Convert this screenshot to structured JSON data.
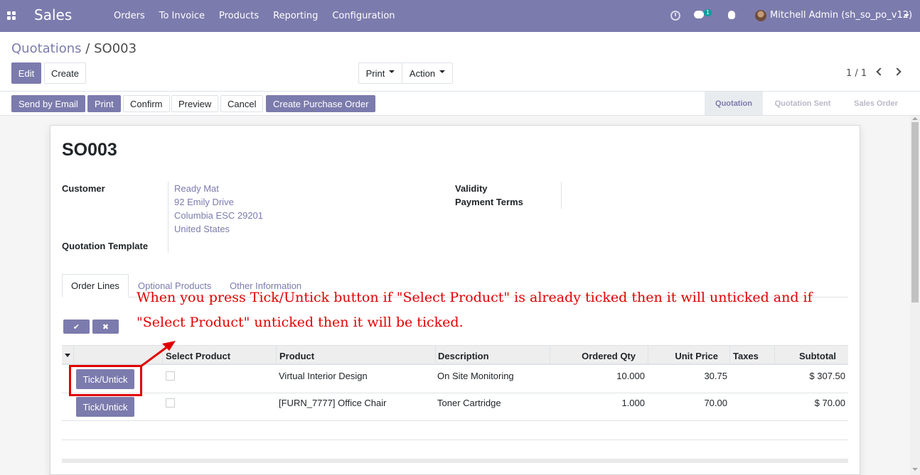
{
  "navbar": {
    "app_name": "Sales",
    "menu": [
      "Orders",
      "To Invoice",
      "Products",
      "Reporting",
      "Configuration"
    ],
    "chat_count": "1",
    "user": "Mitchell Admin (sh_so_po_v12)"
  },
  "breadcrumb": {
    "parent": "Quotations",
    "separator": "/",
    "current": "SO003"
  },
  "controls": {
    "edit": "Edit",
    "create": "Create",
    "print": "Print",
    "action": "Action",
    "pager": "1 / 1"
  },
  "statusbar": {
    "buttons": [
      "Send by Email",
      "Print",
      "Confirm",
      "Preview",
      "Cancel",
      "Create Purchase Order"
    ],
    "stages": [
      "Quotation",
      "Quotation Sent",
      "Sales Order"
    ],
    "active_stage": "Quotation"
  },
  "form": {
    "title": "SO003",
    "customer_label": "Customer",
    "customer_address": [
      "Ready Mat",
      "92 Emily Drive",
      "Columbia ESC 29201",
      "United States"
    ],
    "quotation_template_label": "Quotation Template",
    "validity_label": "Validity",
    "payment_terms_label": "Payment Terms"
  },
  "tabs": [
    "Order Lines",
    "Optional Products",
    "Other Information"
  ],
  "annotation": {
    "line1": "When you press Tick/Untick button if \"Select Product\" is already ticked then it will unticked and if",
    "line2": "\"Select Product\" unticked then it will be ticked."
  },
  "table": {
    "columns": [
      "Select Product",
      "Product",
      "Description",
      "Ordered Qty",
      "Unit Price",
      "Taxes",
      "Subtotal"
    ],
    "rows": [
      {
        "button": "Tick/Untick",
        "selected": false,
        "product": "Virtual Interior Design",
        "description": "On Site Monitoring",
        "qty": "10.000",
        "unit_price": "30.75",
        "taxes": "",
        "subtotal": "$ 307.50"
      },
      {
        "button": "Tick/Untick",
        "selected": false,
        "product": "[FURN_7777] Office Chair",
        "description": "Toner Cartridge",
        "qty": "1.000",
        "unit_price": "70.00",
        "taxes": "",
        "subtotal": "$ 70.00"
      }
    ]
  },
  "colors": {
    "brand": "#7c7bad",
    "annotation": "#e00000"
  },
  "icons": [
    "apps-icon",
    "clock-icon",
    "chat-icon",
    "bug-icon",
    "check-icon",
    "close-icon"
  ]
}
